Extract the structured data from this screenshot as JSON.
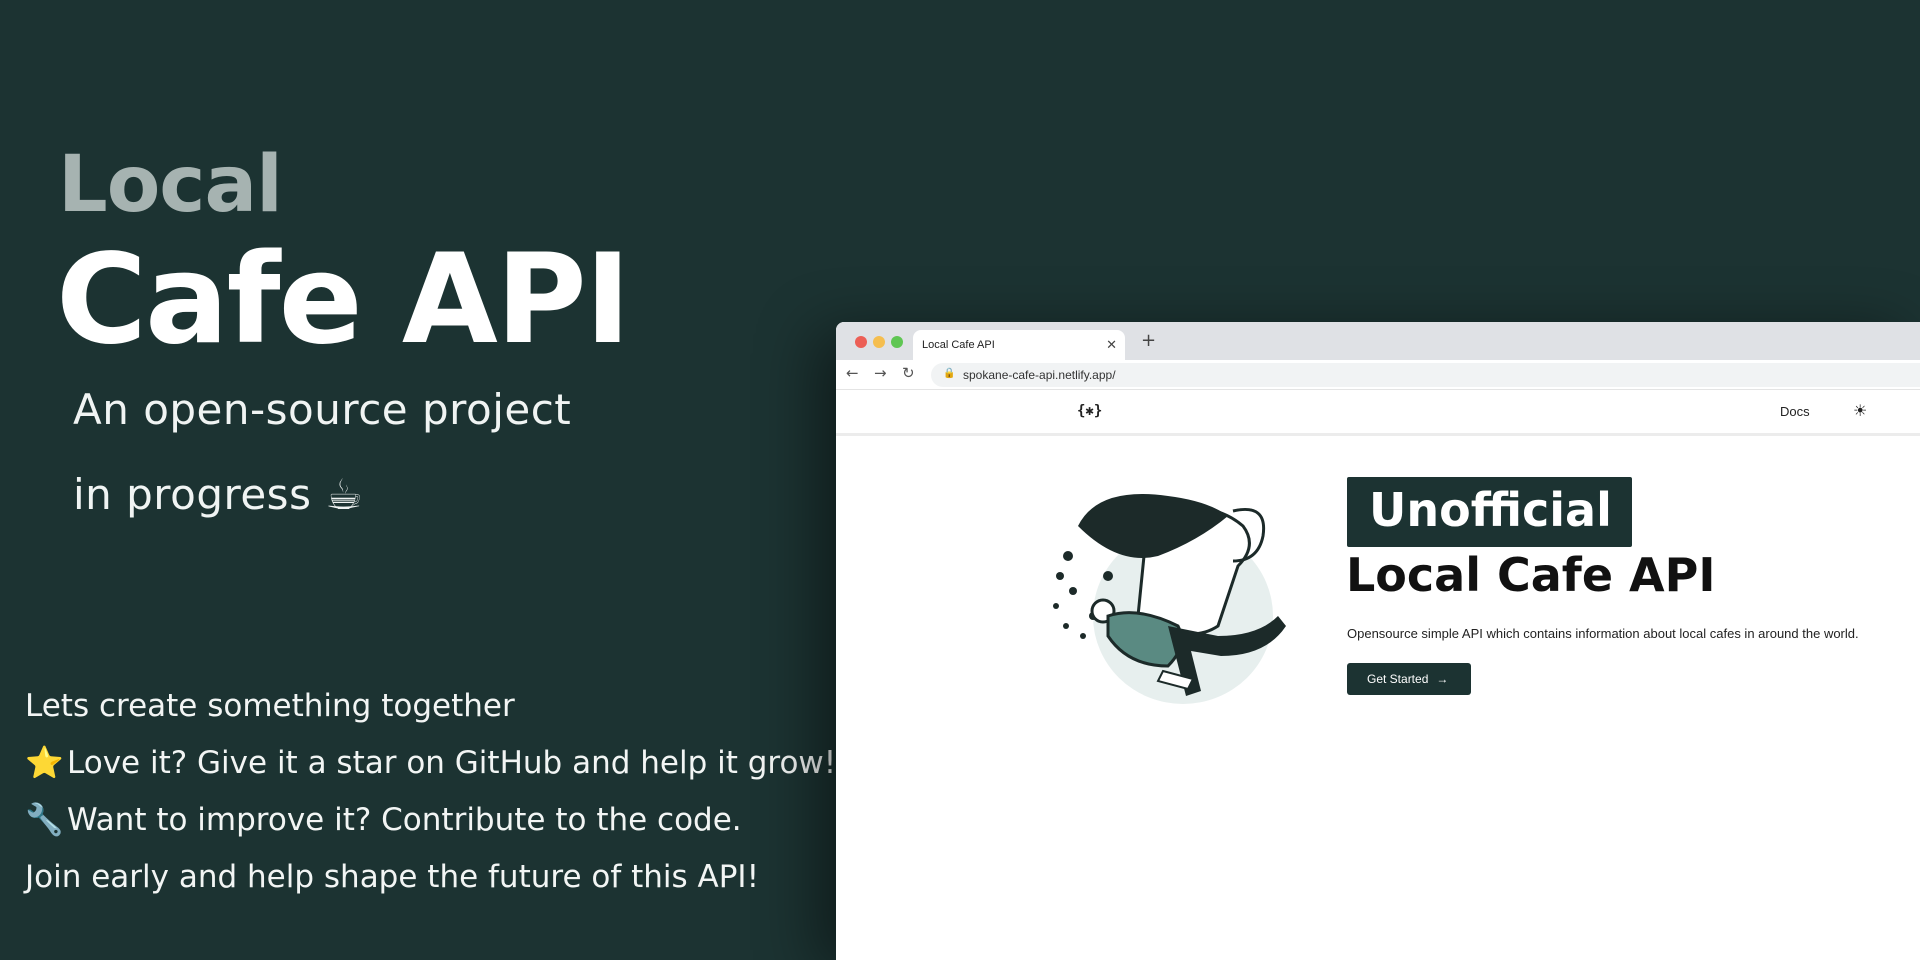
{
  "hero": {
    "title_line1": "Local",
    "title_line2": "Cafe API",
    "subtitle_line1": "An open-source project",
    "subtitle_line2": "in progress ☕",
    "cta_lines": [
      {
        "emoji": "",
        "text": "Lets create something together"
      },
      {
        "emoji": "⭐",
        "text": "Love it? Give it a star on GitHub and help it grow!"
      },
      {
        "emoji": "🔧",
        "text": "Want to improve it? Contribute to the code."
      },
      {
        "emoji": "",
        "text": "Join early and help shape the future of this API!"
      }
    ]
  },
  "browser": {
    "tab_title": "Local Cafe API",
    "tab_close": "✕",
    "new_tab": "+",
    "url": "spokane-cafe-api.netlify.app/",
    "nav_back": "←",
    "nav_forward": "→",
    "nav_reload": "↻",
    "lock": "🔒"
  },
  "site": {
    "logo": "{✱}",
    "nav_docs": "Docs",
    "theme_toggle": "☀",
    "badge": "Unofficial",
    "title": "Local Cafe API",
    "description": "Opensource simple API which contains information about local cafes in around the world.",
    "cta_label": "Get Started",
    "cta_arrow": "→"
  },
  "colors": {
    "background": "#1c3332",
    "accent": "#1c3332",
    "muted_title": "#a6b3b1"
  }
}
